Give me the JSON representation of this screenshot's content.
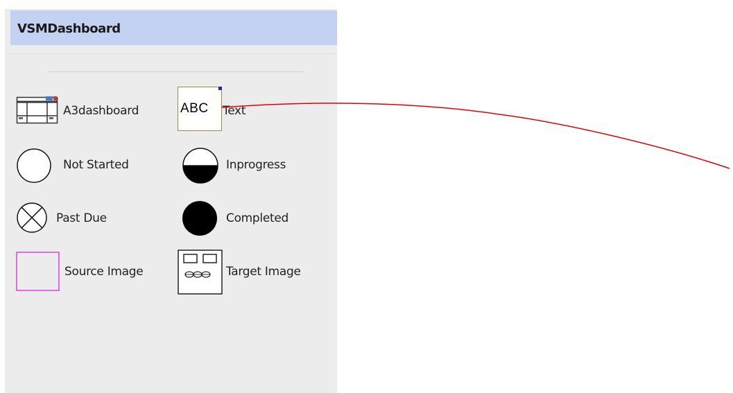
{
  "panel": {
    "title": "VSMDashboard"
  },
  "shapes": [
    {
      "id": "a3dashboard",
      "label": "A3dashboard",
      "icon": "dashboard-frame-icon"
    },
    {
      "id": "text",
      "label": "Text",
      "icon": "text-box-icon",
      "icon_text": "ABC"
    },
    {
      "id": "not-started",
      "label": "Not Started",
      "icon": "empty-circle-icon"
    },
    {
      "id": "inprogress",
      "label": "Inprogress",
      "icon": "half-filled-circle-icon"
    },
    {
      "id": "past-due",
      "label": "Past Due",
      "icon": "crossed-circle-icon"
    },
    {
      "id": "completed",
      "label": "Completed",
      "icon": "filled-circle-icon"
    },
    {
      "id": "source-image",
      "label": "Source Image",
      "icon": "magenta-square-icon"
    },
    {
      "id": "target-image",
      "label": "Target Image",
      "icon": "target-frame-icon"
    }
  ],
  "colors": {
    "header_bg": "#c3d1f2",
    "panel_bg": "#ececec",
    "connector": "#e00000",
    "source_image_border": "#e040e0",
    "selection_handle": "#2020d0",
    "text_box_border": "#9b8c3a"
  }
}
